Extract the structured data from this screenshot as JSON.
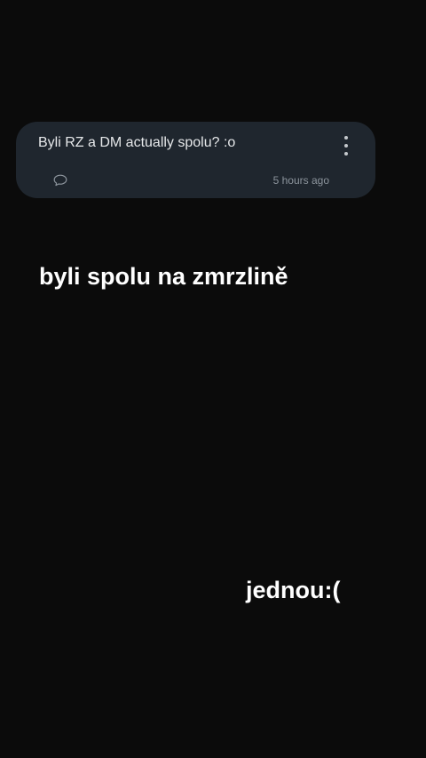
{
  "question_card": {
    "text": "Byli RZ a DM actually spolu? :o",
    "timestamp": "5 hours ago",
    "more_icon": "more-vertical-icon",
    "comment_icon": "comment-bubble-icon"
  },
  "captions": {
    "first": "byli spolu na zmrzlině",
    "second": "jednou:("
  },
  "colors": {
    "background": "#0b0b0b",
    "card": "#1f262e",
    "text_primary": "#ffffff",
    "text_muted": "#8c949c"
  }
}
